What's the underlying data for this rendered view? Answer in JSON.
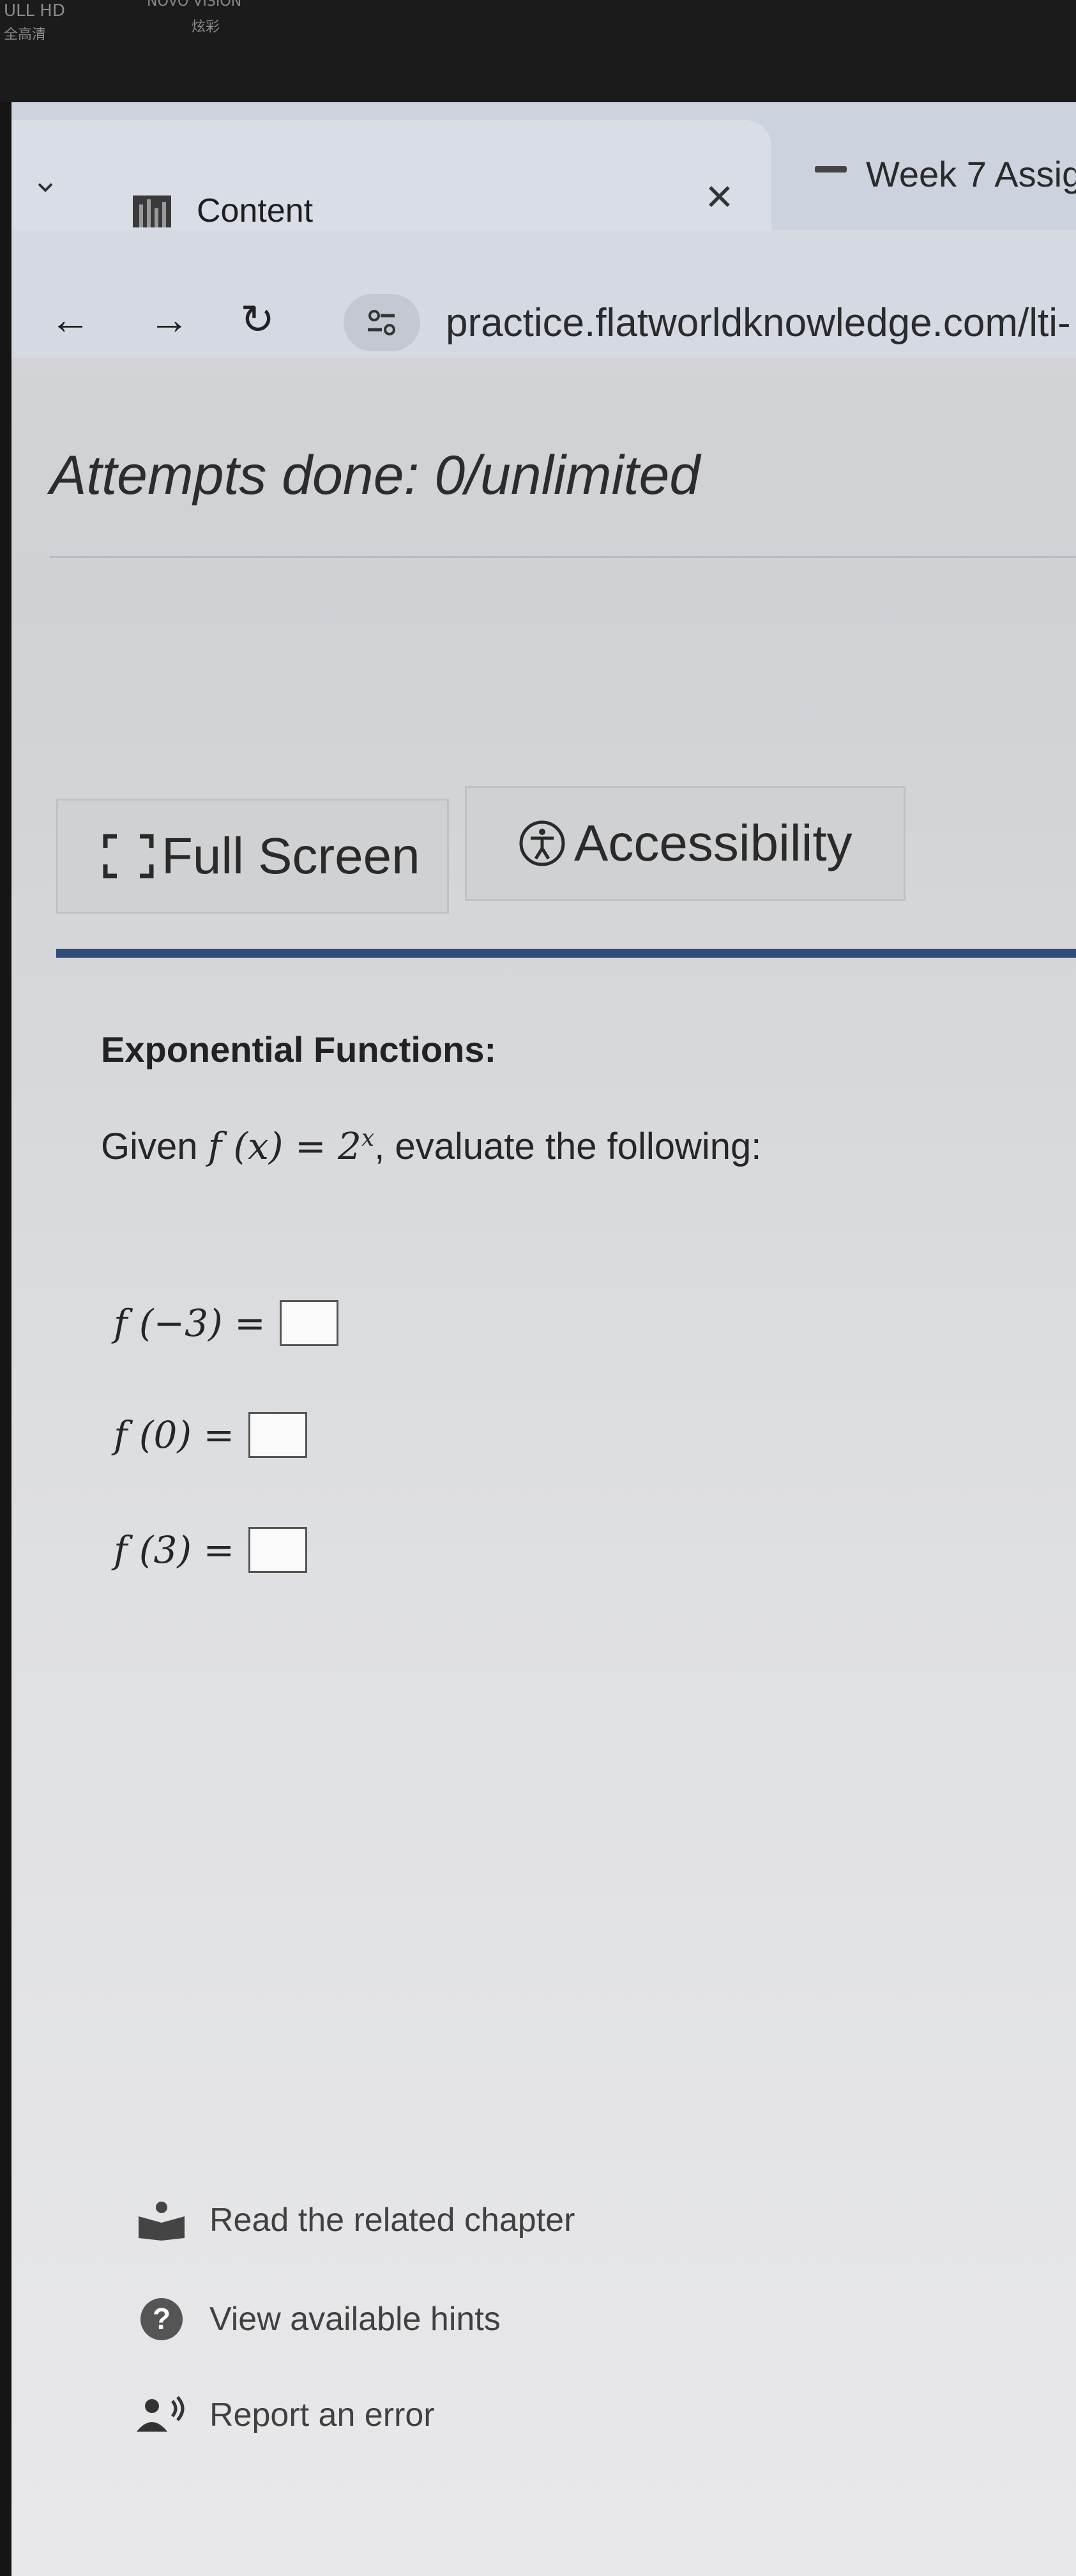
{
  "bezel": {
    "line1": "ULL HD",
    "line2": "全高清",
    "brand": "NOVO VISION",
    "brand_sub": "炫彩"
  },
  "browser": {
    "active_tab_title": "Content",
    "second_tab_title": "Week 7 Assig",
    "url": "practice.flatworldknowledge.com/lti-"
  },
  "page": {
    "attempts": "Attempts done: 0/unlimited",
    "buttons": {
      "full_screen": "Full Screen",
      "accessibility": "Accessibility"
    },
    "section_title": "Exponential Functions:",
    "given": {
      "prefix": "Given ",
      "function": "f (x) = 2",
      "exponent": "x",
      "suffix": ", evaluate the following:"
    },
    "equations": [
      {
        "lhs": "f (−3) =",
        "answer": ""
      },
      {
        "lhs": "f (0) =",
        "answer": ""
      },
      {
        "lhs": "f (3) =",
        "answer": ""
      }
    ],
    "links": {
      "chapter": "Read the related chapter",
      "hints": "View available hints",
      "report": "Report an error"
    }
  },
  "colors": {
    "accent_rule": "#2f4b7c",
    "hint_icon": "#555555"
  }
}
